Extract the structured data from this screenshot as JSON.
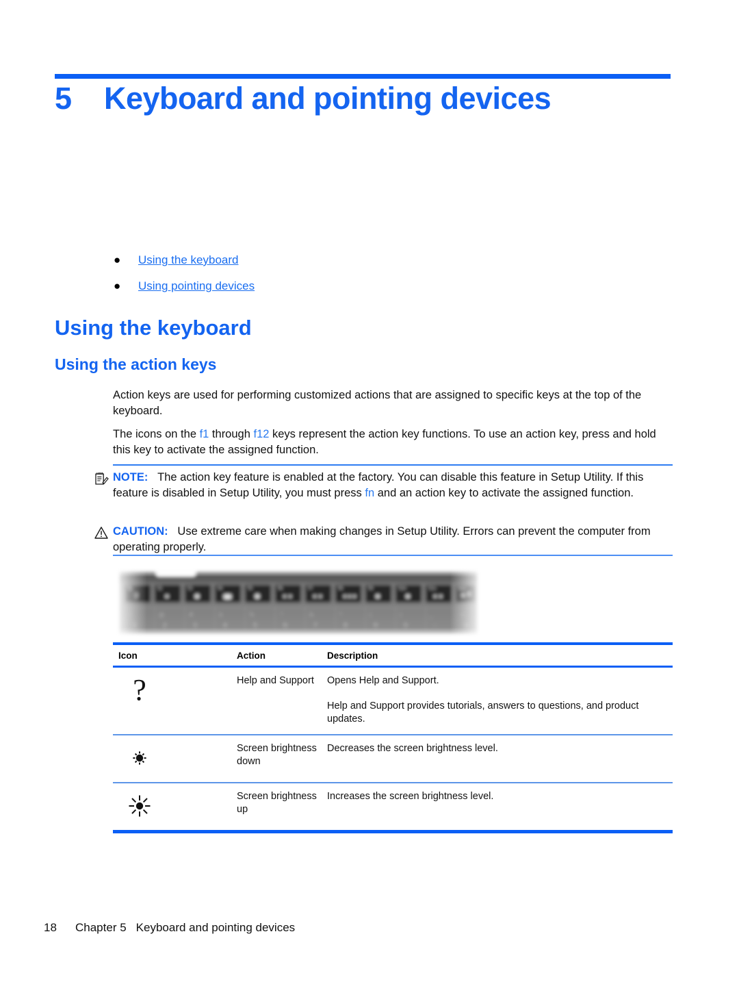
{
  "document": {
    "chapter_number": "5",
    "chapter_title": "Keyboard and pointing devices"
  },
  "toc": {
    "items": [
      {
        "label": "Using the keyboard"
      },
      {
        "label": "Using pointing devices"
      }
    ],
    "bullet": "●"
  },
  "headings": {
    "h1": "Using the keyboard",
    "h2": "Using the action keys"
  },
  "paragraphs": {
    "p1": "Action keys are used for performing customized actions that are assigned to specific keys at the top of the keyboard.",
    "p2_a": "The icons on the ",
    "p2_k1": "f1",
    "p2_b": " through ",
    "p2_k2": "f12",
    "p2_c": " keys represent the action key functions. To use an action key, press and hold this key to activate the assigned function."
  },
  "note": {
    "label": "NOTE:",
    "text_a": "The action key feature is enabled at the factory. You can disable this feature in Setup Utility. If this feature is disabled in Setup Utility, you must press ",
    "key": "fn",
    "text_b": " and an action key to activate the assigned function."
  },
  "caution": {
    "label": "CAUTION:",
    "text": "Use extreme care when making changes in Setup Utility. Errors can prevent the computer from operating properly."
  },
  "table": {
    "headers": {
      "icon": "Icon",
      "action": "Action",
      "description": "Description"
    },
    "rows": [
      {
        "icon_name": "question-mark-icon",
        "action": "Help and Support",
        "description": [
          "Opens Help and Support.",
          "Help and Support provides tutorials, answers to questions, and product updates."
        ]
      },
      {
        "icon_name": "brightness-down-icon",
        "action": "Screen brightness down",
        "description": [
          "Decreases the screen brightness level."
        ]
      },
      {
        "icon_name": "brightness-up-icon",
        "action": "Screen brightness up",
        "description": [
          "Increases the screen brightness level."
        ]
      }
    ]
  },
  "footer": {
    "page_number": "18",
    "chapter": "Chapter 5",
    "title": "Keyboard and pointing devices"
  },
  "colors": {
    "accent_blue": "#0b5ff5",
    "heading_blue": "#1464f0",
    "link_blue": "#1a6ef0",
    "rule_light_blue": "#5d96e8"
  }
}
